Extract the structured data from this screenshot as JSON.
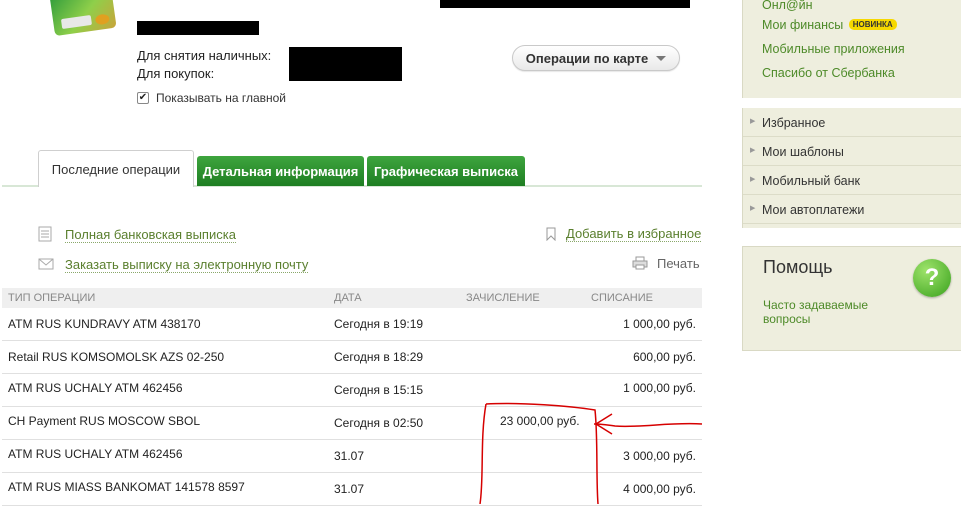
{
  "account": {
    "cash_label": "Для снятия наличных:",
    "purchases_label": "Для покупок:",
    "show_on_main_label": "Показывать на главной",
    "show_on_main_checked": true,
    "checkbox_mark": "✔",
    "ops_button_label": "Операции по карте"
  },
  "tabs": [
    {
      "label": "Последние операции",
      "active": true
    },
    {
      "label": "Детальная информация",
      "active": false
    },
    {
      "label": "Графическая выписка",
      "active": false
    }
  ],
  "actions": {
    "full_statement": "Полная банковская выписка",
    "email_statement": "Заказать выписку на электронную почту",
    "add_favorite": "Добавить в избранное",
    "print": "Печать"
  },
  "table": {
    "headers": {
      "type": "ТИП ОПЕРАЦИИ",
      "date": "ДАТА",
      "credit": "ЗАЧИСЛЕНИЕ",
      "debit": "СПИСАНИЕ"
    },
    "rows": [
      {
        "type": "ATM RUS KUNDRAVY ATM 438170",
        "date": "Сегодня в 19:19",
        "credit": "",
        "debit": "1 000,00 руб."
      },
      {
        "type": "Retail RUS KOMSOMOLSK AZS 02-250",
        "date": "Сегодня в 18:29",
        "credit": "",
        "debit": "600,00 руб."
      },
      {
        "type": "ATM RUS UCHALY ATM 462456",
        "date": "Сегодня в 15:15",
        "credit": "",
        "debit": "1 000,00 руб."
      },
      {
        "type": "CH Payment RUS MOSCOW SBOL",
        "date": "Сегодня в 02:50",
        "credit": "23 000,00 руб.",
        "debit": ""
      },
      {
        "type": "ATM RUS UCHALY ATM 462456",
        "date": "31.07",
        "credit": "",
        "debit": "3 000,00 руб."
      },
      {
        "type": "ATM RUS MIASS BANKOMAT 141578 8597",
        "date": "31.07",
        "credit": "",
        "debit": "4 000,00 руб."
      }
    ]
  },
  "sidebar": {
    "top_links": [
      {
        "label": "Онл@йн"
      },
      {
        "label": "Мои финансы",
        "badge": "НОВИНКА"
      },
      {
        "label": "Мобильные приложения"
      },
      {
        "label": "Спасибо от Сбербанка"
      }
    ],
    "menu": [
      "Избранное",
      "Мои шаблоны",
      "Мобильный банк",
      "Мои автоплатежи"
    ],
    "help": {
      "title": "Помощь",
      "link": "Часто задаваемые вопросы",
      "icon_glyph": "?"
    }
  },
  "colors": {
    "accent_green": "#2e8b2e",
    "link_green": "#4d8a28",
    "annotation_red": "#d60000"
  }
}
